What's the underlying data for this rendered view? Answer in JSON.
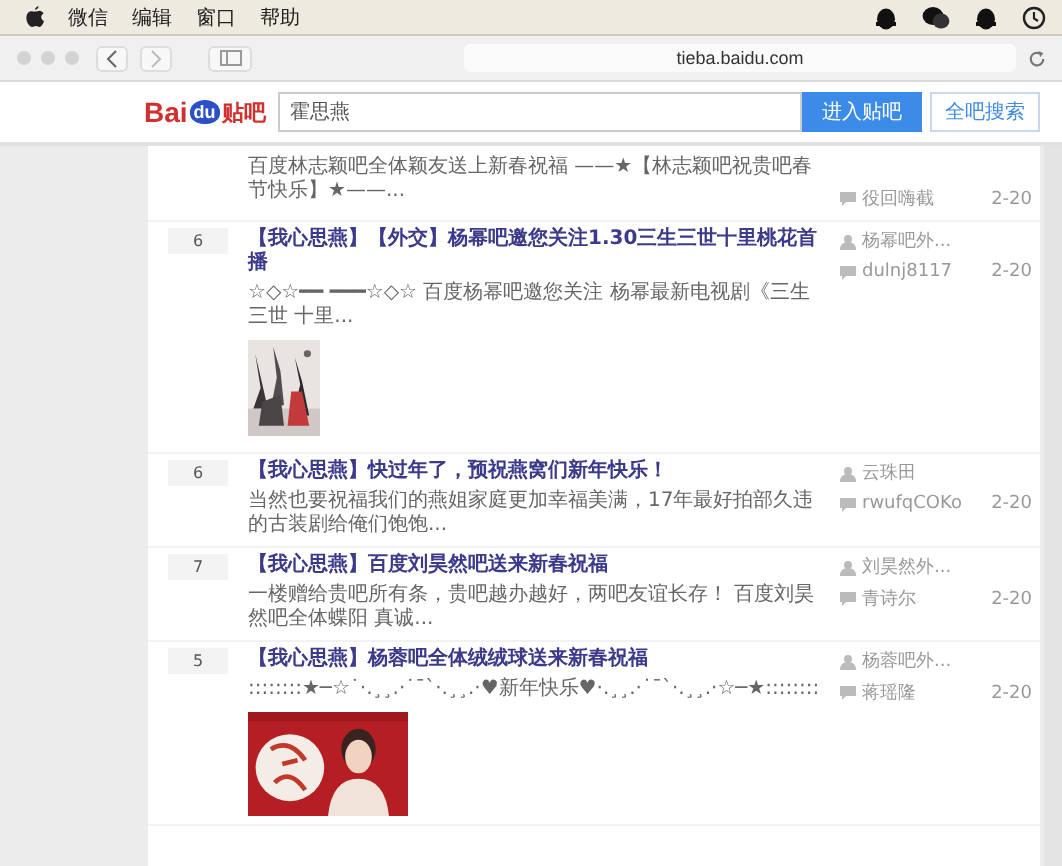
{
  "menu_bar": {
    "items": [
      "微信",
      "编辑",
      "窗口",
      "帮助"
    ]
  },
  "browser": {
    "url": "tieba.baidu.com"
  },
  "header": {
    "logo": {
      "left": "Bai",
      "paw": "du",
      "right": "贴吧"
    },
    "search_value": "霍思燕",
    "buttons": [
      "进入贴吧",
      "全吧搜索"
    ]
  },
  "threads": [
    {
      "abstract": "百度林志颖吧全体颖友送上新春祝福 ——★【林志颖吧祝贵吧春节快乐】★——...",
      "last_replier": "役回嗨截",
      "date": "2-20"
    },
    {
      "reply_count": "6",
      "title": "【我心思燕】【外交】杨幂吧邀您关注1.30三生三世十里桃花首播",
      "author": "杨幂吧外...",
      "abstract": "☆◇☆━━ ━━━☆◇☆ 百度杨幂吧邀您关注 杨幂最新电视剧《三生三世 十里...",
      "last_replier": "dulnj8117",
      "date": "2-20",
      "picture": {
        "kind": "poster"
      }
    },
    {
      "reply_count": "6",
      "title": "【我心思燕】快过年了，预祝燕窝们新年快乐！",
      "author": "云珠田",
      "abstract": "当然也要祝福我们的燕姐家庭更加幸福美满，17年最好拍部久违的古装剧给俺们饱饱...",
      "last_replier": "rwufqCOKo",
      "date": "2-20"
    },
    {
      "reply_count": "7",
      "title": "【我心思燕】百度刘昊然吧送来新春祝福",
      "author": "刘昊然外...",
      "abstract": "一楼赠给贵吧所有条，贵吧越办越好，两吧友谊长存！ 百度刘昊然吧全体蝶阳 真诚...",
      "last_replier": "青诗尔",
      "date": "2-20"
    },
    {
      "reply_count": "5",
      "title": "【我心思燕】杨蓉吧全体绒绒球送来新春祝福",
      "author": "杨蓉吧外...",
      "abstract": "::::::::★─☆˙·.¸¸.·˙¯`·.¸¸.·♥新年快乐♥·.¸¸.·˙¯`·.¸¸.·☆─★::::::::",
      "last_replier": "蒋瑶隆",
      "date": "2-20",
      "picture": {
        "kind": "portrait"
      }
    }
  ]
}
